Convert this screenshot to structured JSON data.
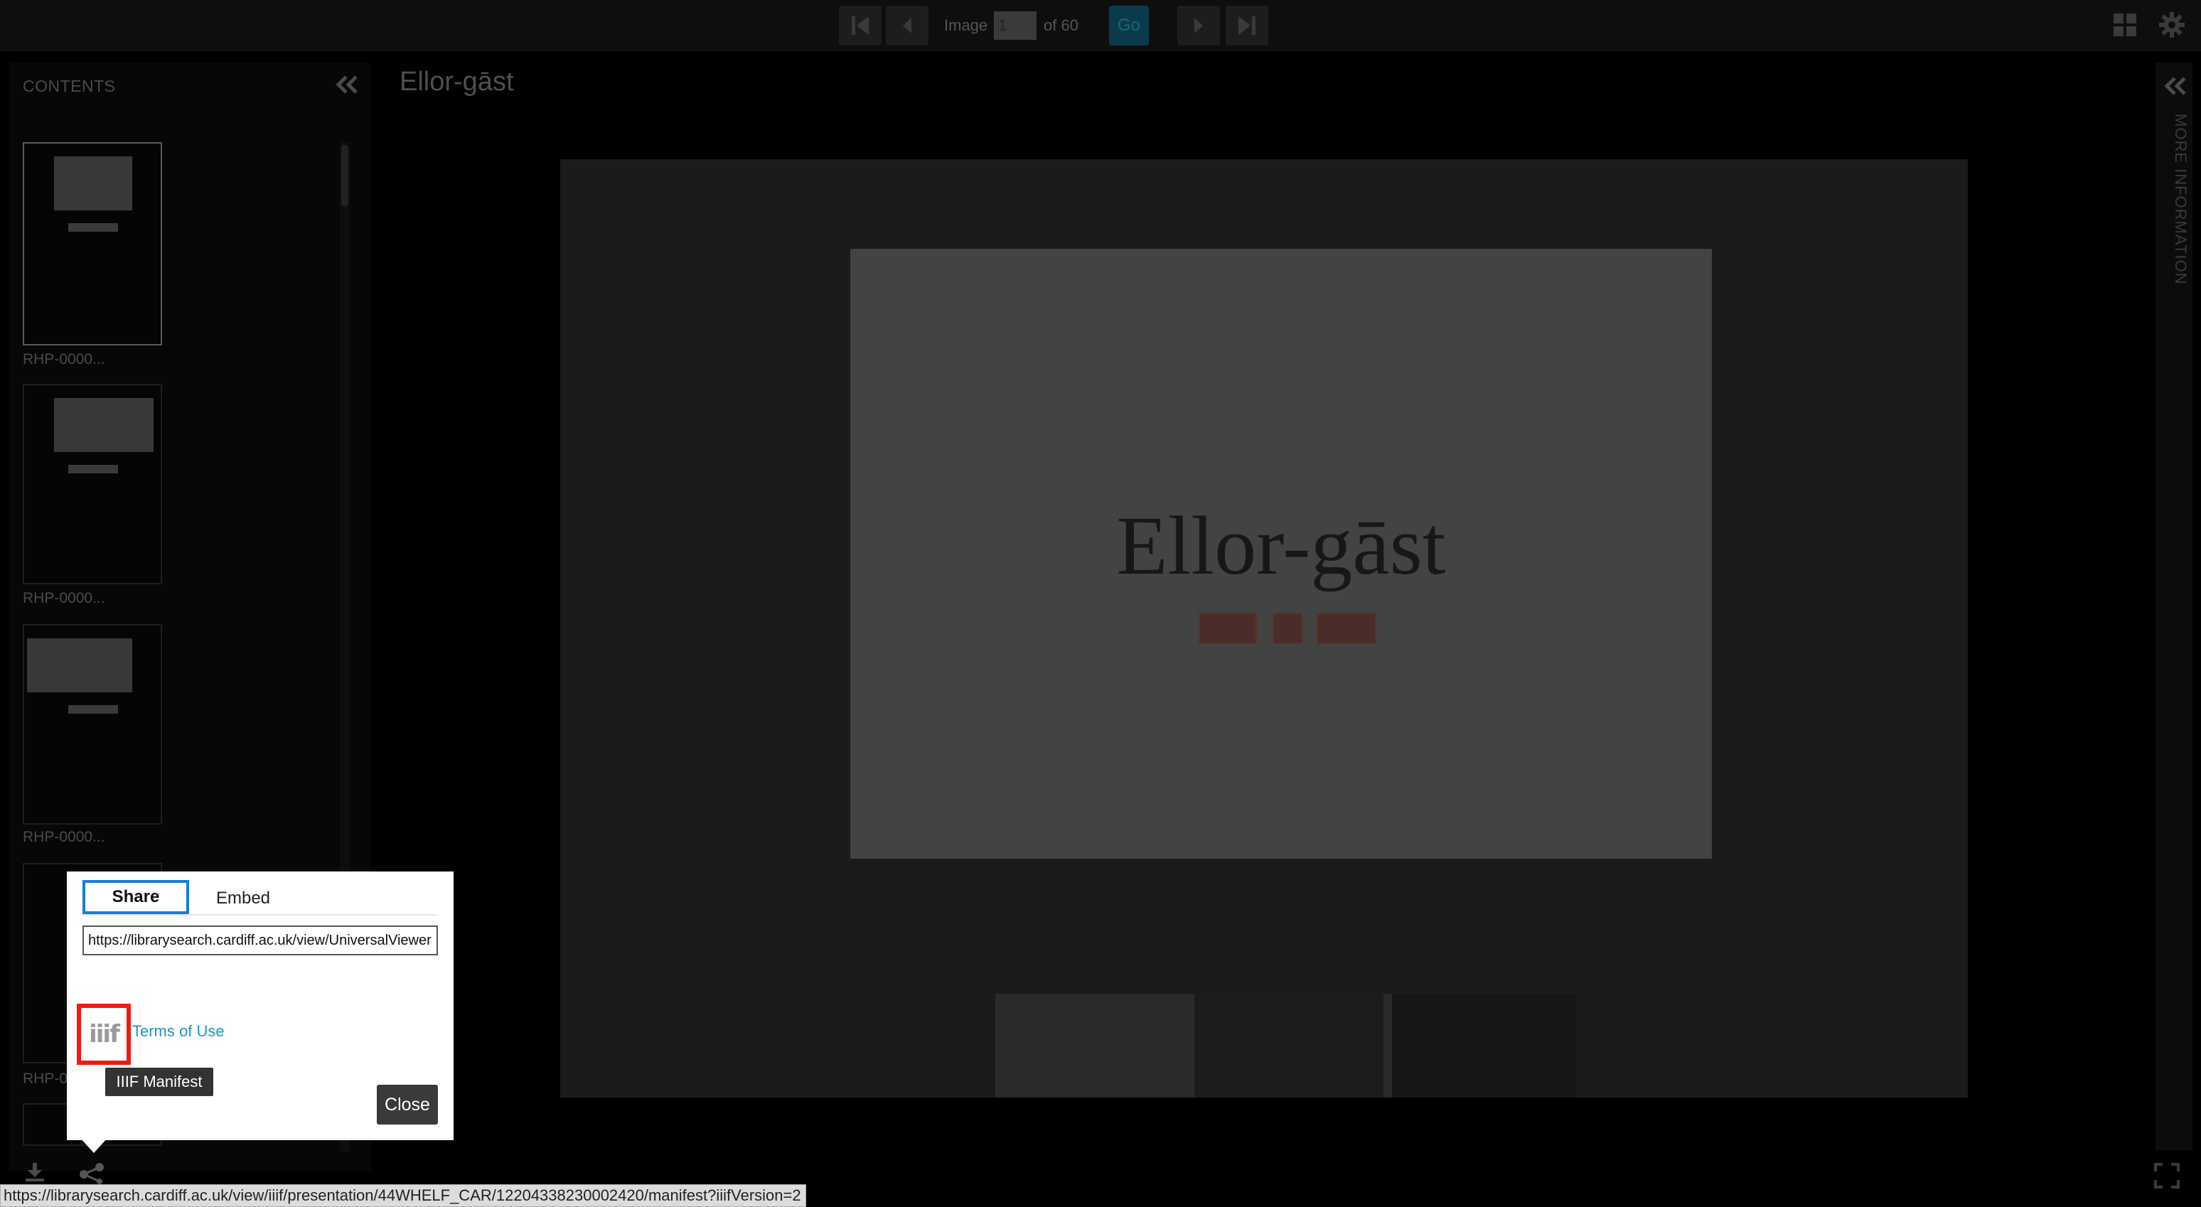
{
  "toolbar": {
    "image_label": "Image",
    "current_page": "1",
    "of_label": "of 60",
    "go_label": "Go"
  },
  "contents": {
    "title": "CONTENTS",
    "thumbnails": [
      {
        "label": "RHP-0000..."
      },
      {
        "label": "RHP-0000..."
      },
      {
        "label": "RHP-0000..."
      },
      {
        "label": "RHP-0"
      }
    ]
  },
  "viewer": {
    "doc_title": "Ellor-gāst",
    "card_title": "Ellor-gāst"
  },
  "right_panel": {
    "label": "MORE INFORMATION"
  },
  "share_dialog": {
    "tab_share": "Share",
    "tab_embed": "Embed",
    "url_value": "https://librarysearch.cardiff.ac.uk/view/UniversalViewer",
    "iiif_logo": "iiif",
    "terms_link": "Terms of Use",
    "tooltip": "IIIF Manifest",
    "close_label": "Close"
  },
  "status_bar": {
    "url": "https://librarysearch.cardiff.ac.uk/view/iiif/presentation/44WHELF_CAR/12204338230002420/manifest?iiifVersion=2"
  },
  "icons": [
    "first-page-icon",
    "prev-page-icon",
    "next-page-icon",
    "last-page-icon",
    "grid-view-icon",
    "gear-icon",
    "collapse-left-icon",
    "collapse-right-icon",
    "download-icon",
    "share-icon",
    "fullscreen-icon",
    "iiif-logo-icon"
  ],
  "colors": {
    "accent_blue": "#1d7bd6",
    "link": "#1d96c0",
    "highlight_red": "#ee1c0e",
    "go_button": "#0b3b4a"
  }
}
